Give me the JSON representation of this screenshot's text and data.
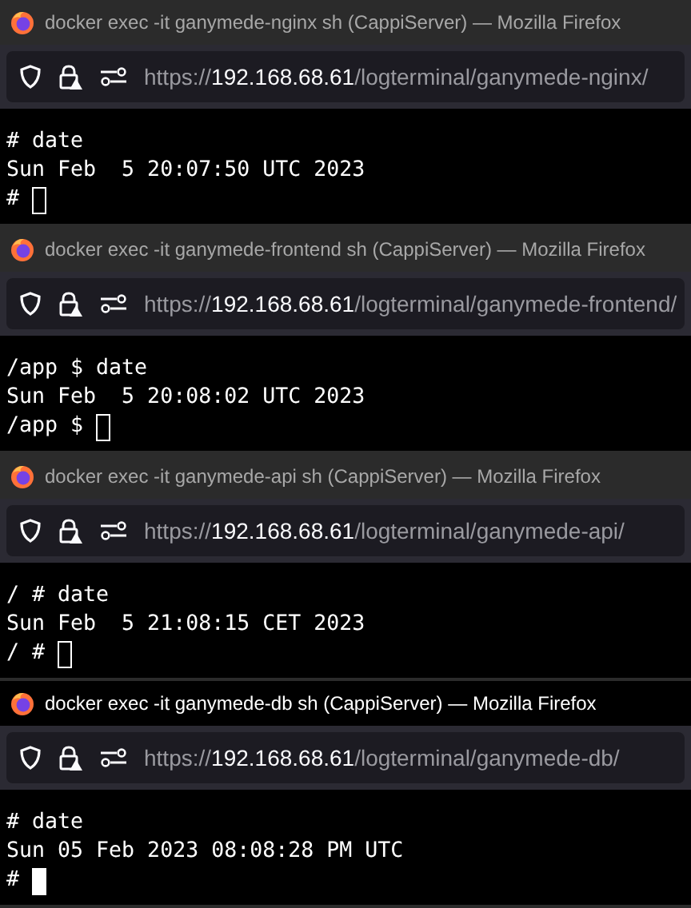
{
  "windows": [
    {
      "title": "docker exec -it ganymede-nginx sh (CappiServer) — Mozilla Firefox",
      "focused": false,
      "url": {
        "scheme": "https://",
        "host": "192.168.68.61",
        "path": "/logterminal/ganymede-nginx/"
      },
      "lines": [
        "# date",
        "Sun Feb  5 20:07:50 UTC 2023"
      ],
      "prompt": "# "
    },
    {
      "title": "docker exec -it ganymede-frontend sh (CappiServer) — Mozilla Firefox",
      "focused": false,
      "url": {
        "scheme": "https://",
        "host": "192.168.68.61",
        "path": "/logterminal/ganymede-frontend/"
      },
      "lines": [
        "/app $ date",
        "Sun Feb  5 20:08:02 UTC 2023"
      ],
      "prompt": "/app $ "
    },
    {
      "title": "docker exec -it ganymede-api sh (CappiServer) — Mozilla Firefox",
      "focused": false,
      "url": {
        "scheme": "https://",
        "host": "192.168.68.61",
        "path": "/logterminal/ganymede-api/"
      },
      "lines": [
        "/ # date",
        "Sun Feb  5 21:08:15 CET 2023"
      ],
      "prompt": "/ # "
    },
    {
      "title": "docker exec -it ganymede-db sh (CappiServer) — Mozilla Firefox",
      "focused": true,
      "url": {
        "scheme": "https://",
        "host": "192.168.68.61",
        "path": "/logterminal/ganymede-db/"
      },
      "lines": [
        "# date",
        "Sun 05 Feb 2023 08:08:28 PM UTC"
      ],
      "prompt": "# "
    }
  ]
}
